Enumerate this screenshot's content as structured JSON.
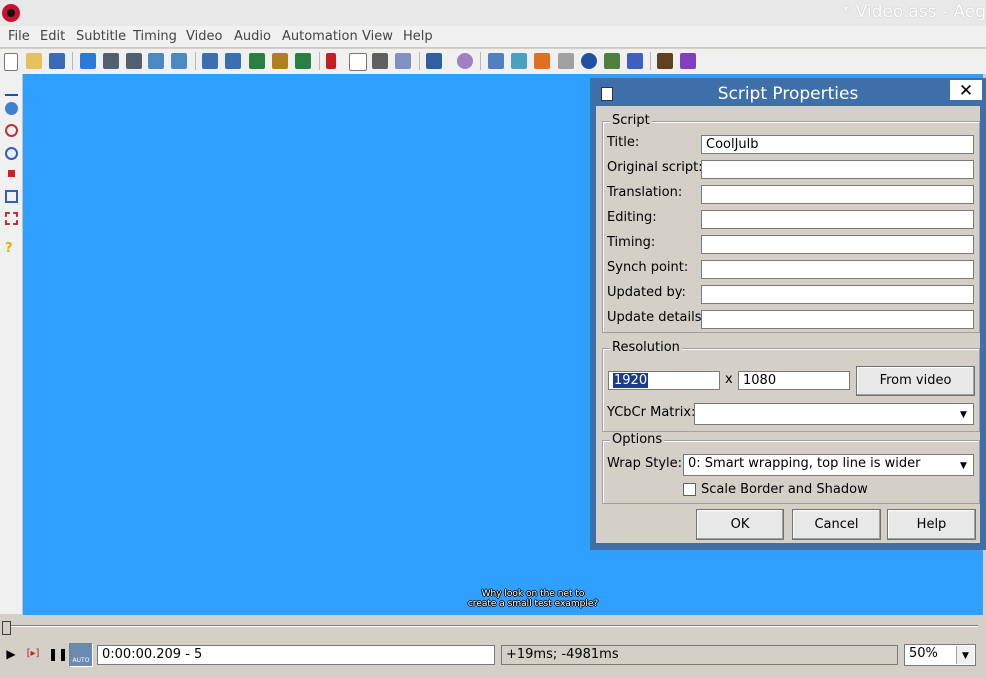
{
  "window": {
    "title": "* Video.ass - Aeg"
  },
  "menu": [
    "File",
    "Edit",
    "Subtitle",
    "Timing",
    "Video",
    "Audio",
    "Automation",
    "View",
    "Help"
  ],
  "video": {
    "subtitle_text": "Why look on the net to\ncreate a small test example?",
    "background": "#30a0ff"
  },
  "playback": {
    "time": "0:00:00.209 - 5",
    "offset": "+19ms; -4981ms",
    "zoom": "50%",
    "zoom_arrow": "▼",
    "auto_label": "AUTO"
  },
  "dialog": {
    "title": "Script Properties",
    "close": "✕",
    "script_group": "Script",
    "fields": [
      {
        "label": "Title:",
        "value": "CoolJulb"
      },
      {
        "label": "Original script:",
        "value": ""
      },
      {
        "label": "Translation:",
        "value": ""
      },
      {
        "label": "Editing:",
        "value": ""
      },
      {
        "label": "Timing:",
        "value": ""
      },
      {
        "label": "Synch point:",
        "value": ""
      },
      {
        "label": "Updated by:",
        "value": ""
      },
      {
        "label": "Update details:",
        "value": ""
      }
    ],
    "resolution_group": "Resolution",
    "res_width": "1920",
    "res_x": "x",
    "res_height": "1080",
    "from_video": "From video",
    "ycbcr_label": "YCbCr Matrix:",
    "ycbcr_value": "",
    "options_group": "Options",
    "wrap_label": "Wrap Style:",
    "wrap_value": "0: Smart wrapping, top line is wider",
    "scale_label": "Scale Border and Shadow",
    "scale_checked": false,
    "ok": "OK",
    "cancel": "Cancel",
    "help": "Help"
  }
}
